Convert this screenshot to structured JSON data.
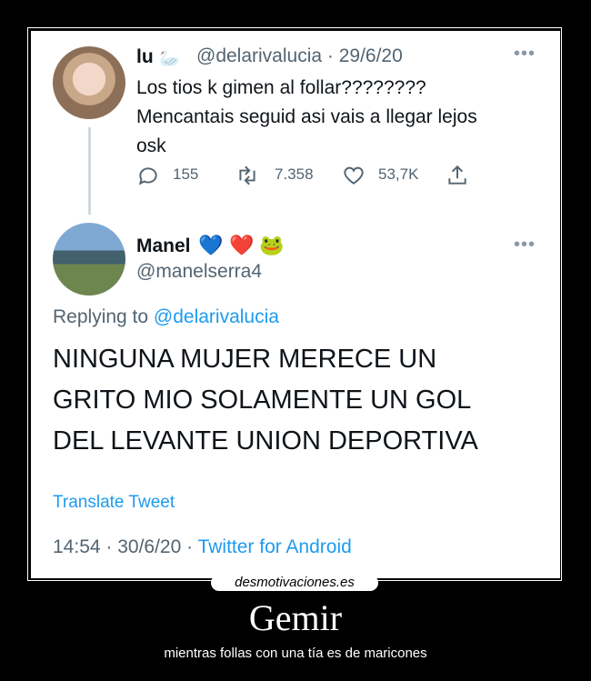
{
  "tweet_original": {
    "name": "lu",
    "meta": "@delarivalucia · 29/6/20",
    "text_line1": "Los tios k gimen al follar????????",
    "text_line2": "Mencantais seguid asi vais a llegar lejos",
    "text_line3": "osk",
    "replies": "155",
    "retweets": "7.358",
    "likes": "53,7K"
  },
  "tweet_reply": {
    "name": "Manel",
    "handle": "@manelserra4",
    "replying_prefix": "Replying to",
    "replying_handle": "@delarivalucia",
    "line1": "NINGUNA MUJER MERECE UN",
    "line2": "GRITO MIO SOLAMENTE UN GOL",
    "line3": "DEL LEVANTE UNION DEPORTIVA",
    "translate": "Translate Tweet",
    "time_date": "14:54 · 30/6/20 · ",
    "source": "Twitter for Android"
  },
  "poster": {
    "watermark": "desmotivaciones.es",
    "title": "Gemir",
    "subtitle": "mientras follas con una tía es de maricones"
  }
}
